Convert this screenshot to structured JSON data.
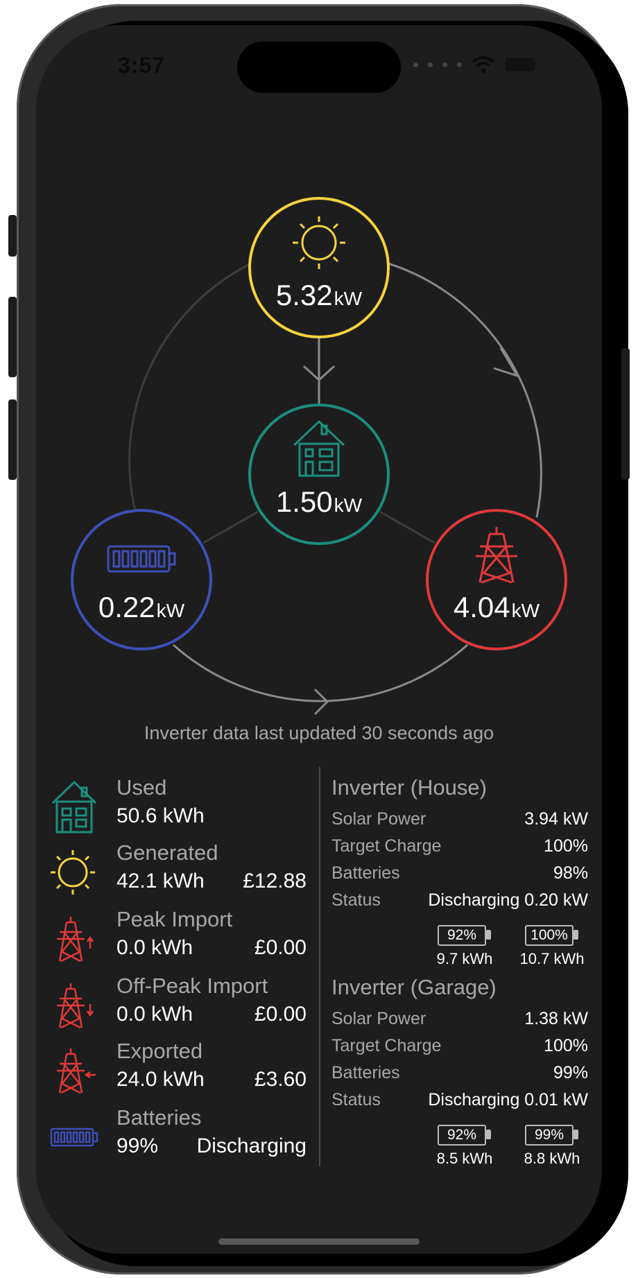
{
  "status_bar": {
    "time": "3:57"
  },
  "flow": {
    "solar": {
      "value": "5.32",
      "unit": "kW"
    },
    "house": {
      "value": "1.50",
      "unit": "kW"
    },
    "battery": {
      "value": "0.22",
      "unit": "kW"
    },
    "grid": {
      "value": "4.04",
      "unit": "kW"
    }
  },
  "updated_text": "Inverter data last updated 30 seconds ago",
  "stats": [
    {
      "label": "Used",
      "value": "50.6 kWh",
      "extra": ""
    },
    {
      "label": "Generated",
      "value": "42.1 kWh",
      "extra": "£12.88"
    },
    {
      "label": "Peak Import",
      "value": "0.0 kWh",
      "extra": "£0.00"
    },
    {
      "label": "Off-Peak Import",
      "value": "0.0 kWh",
      "extra": "£0.00"
    },
    {
      "label": "Exported",
      "value": "24.0 kWh",
      "extra": "£3.60"
    },
    {
      "label": "Batteries",
      "value": "99%",
      "extra": "Discharging"
    }
  ],
  "inverters": [
    {
      "title": "Inverter (House)",
      "rows": [
        {
          "k": "Solar Power",
          "v": "3.94 kW"
        },
        {
          "k": "Target Charge",
          "v": "100%"
        },
        {
          "k": "Batteries",
          "v": "98%"
        },
        {
          "k": "Status",
          "v": "Discharging 0.20 kW"
        }
      ],
      "batteries": [
        {
          "pct": "92%",
          "kwh": "9.7 kWh"
        },
        {
          "pct": "100%",
          "kwh": "10.7 kWh"
        }
      ]
    },
    {
      "title": "Inverter (Garage)",
      "rows": [
        {
          "k": "Solar Power",
          "v": "1.38 kW"
        },
        {
          "k": "Target Charge",
          "v": "100%"
        },
        {
          "k": "Batteries",
          "v": "99%"
        },
        {
          "k": "Status",
          "v": "Discharging 0.01 kW"
        }
      ],
      "batteries": [
        {
          "pct": "92%",
          "kwh": "8.5 kWh"
        },
        {
          "pct": "99%",
          "kwh": "8.8 kWh"
        }
      ]
    }
  ],
  "colors": {
    "solar": "#f6d33f",
    "house": "#1b8f7e",
    "battery": "#3d4fb8",
    "grid": "#e1393a",
    "ring": "#7d7d7d"
  },
  "icons": {
    "solar": "sun-icon",
    "house": "house-icon",
    "battery": "battery-icon",
    "grid": "pylon-icon"
  }
}
